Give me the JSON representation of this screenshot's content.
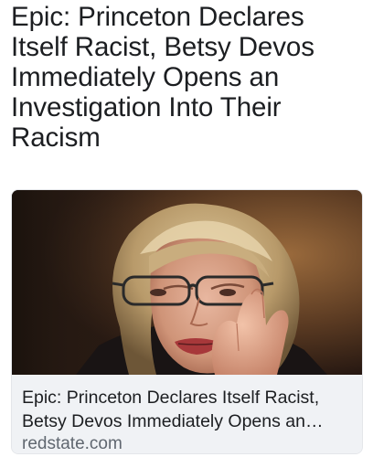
{
  "post": {
    "text": "Epic: Princeton Declares Itself Racist, Betsy Devos Immediately Opens an Investigation Into Their Racism"
  },
  "link_preview": {
    "image_alt": "Photo of Betsy Devos speaking at a hearing",
    "title": "Epic: Princeton Declares Itself Racist, Betsy Devos Immediately Opens an Investigation Into Their Racism",
    "domain": "redstate.com"
  },
  "colors": {
    "text": "#1c1e21",
    "secondary_text": "#606770",
    "card_background": "#f0f2f5"
  }
}
